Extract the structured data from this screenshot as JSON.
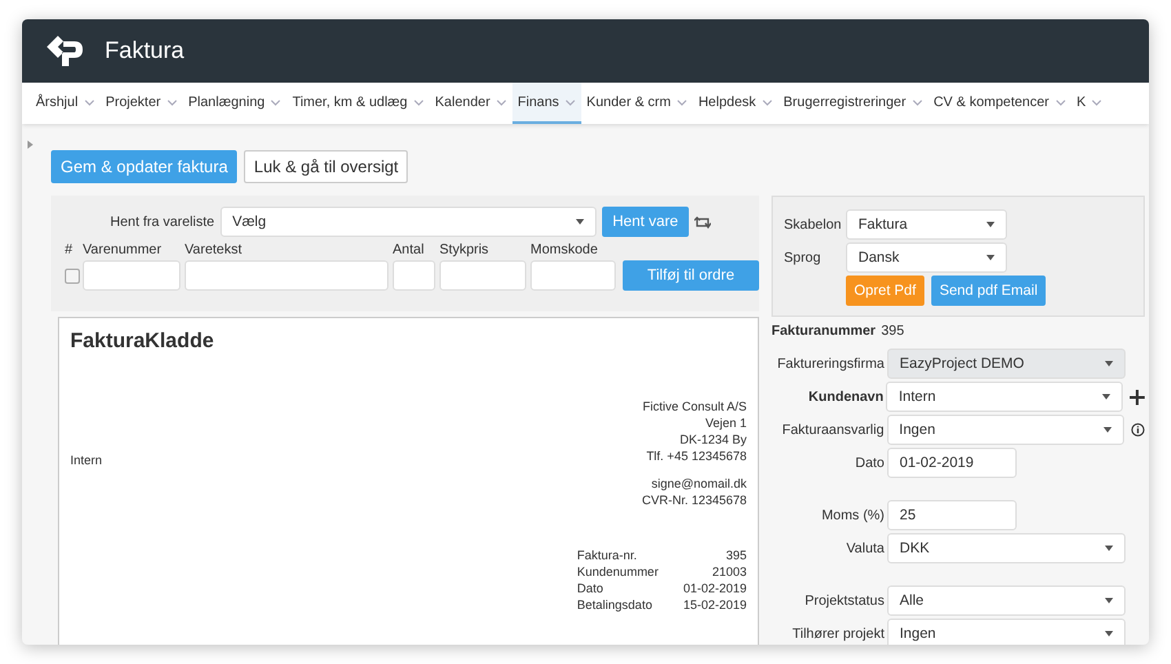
{
  "header": {
    "title": "Faktura"
  },
  "nav": [
    {
      "label": "Årshjul",
      "selected": false
    },
    {
      "label": "Projekter",
      "selected": false
    },
    {
      "label": "Planlægning",
      "selected": false
    },
    {
      "label": "Timer, km & udlæg",
      "selected": false
    },
    {
      "label": "Kalender",
      "selected": false
    },
    {
      "label": "Finans",
      "selected": true
    },
    {
      "label": "Kunder & crm",
      "selected": false
    },
    {
      "label": "Helpdesk",
      "selected": false
    },
    {
      "label": "Brugerregistreringer",
      "selected": false
    },
    {
      "label": "CV & kompetencer",
      "selected": false
    },
    {
      "label": "K",
      "selected": false
    }
  ],
  "actions": [
    {
      "label": "Gem & opdater faktura",
      "kind": "primary"
    },
    {
      "label": "Luk & gå til oversigt",
      "kind": "default"
    }
  ],
  "item_entry": {
    "pick_label": "Hent fra vareliste",
    "pick_value": "Vælg",
    "pick_button": "Hent vare",
    "columns": [
      "#",
      "Varenummer",
      "Varetekst",
      "Antal",
      "Stykpris",
      "Momskode"
    ],
    "row_checked": false,
    "add_button": "Tilføj til ordre"
  },
  "pdf_panel": {
    "fields": [
      {
        "label": "Skabelon",
        "value": "Faktura"
      },
      {
        "label": "Sprog",
        "value": "Dansk"
      }
    ],
    "buttons": [
      {
        "label": "Opret Pdf",
        "kind": "warning"
      },
      {
        "label": "Send pdf Email",
        "kind": "primary"
      }
    ]
  },
  "invoice_form": [
    [
      {
        "kind": "text",
        "label": "Fakturanummer",
        "value": "395",
        "bold": true,
        "add_button": false,
        "info_icon": false
      },
      {
        "kind": "select",
        "label": "Faktureringsfirma",
        "value": "EazyProject DEMO",
        "bold": false,
        "disabled": true,
        "add_button": false,
        "info_icon": false
      },
      {
        "kind": "select",
        "label": "Kundenavn",
        "value": "Intern",
        "bold": true,
        "disabled": false,
        "add_button": true,
        "info_icon": false
      },
      {
        "kind": "select",
        "label": "Fakturaansvarlig",
        "value": "Ingen",
        "bold": false,
        "disabled": false,
        "add_button": false,
        "info_icon": true
      },
      {
        "kind": "input",
        "label": "Dato",
        "value": "01-02-2019",
        "bold": false,
        "add_button": false,
        "info_icon": false
      }
    ],
    [
      {
        "kind": "input",
        "label": "Moms (%)",
        "value": "25",
        "bold": false,
        "add_button": false,
        "info_icon": false
      },
      {
        "kind": "select",
        "label": "Valuta",
        "value": "DKK",
        "bold": false,
        "disabled": false,
        "add_button": false,
        "info_icon": false
      }
    ],
    [
      {
        "kind": "select",
        "label": "Projektstatus",
        "value": "Alle",
        "bold": false,
        "disabled": false,
        "add_button": false,
        "info_icon": false
      },
      {
        "kind": "select",
        "label": "Tilhører projekt",
        "value": "Ingen",
        "bold": false,
        "disabled": false,
        "add_button": false,
        "info_icon": false
      }
    ]
  ],
  "preview": {
    "title": "FakturaKladde",
    "customer": "Intern",
    "sender": [
      [
        "Fictive Consult A/S",
        "Vejen 1",
        "DK-1234 By",
        "Tlf. +45 12345678"
      ],
      [
        "signe@nomail.dk",
        "CVR-Nr. 12345678"
      ]
    ],
    "details": [
      {
        "label": "Faktura-nr.",
        "value": "395"
      },
      {
        "label": "Kundenummer",
        "value": "21003"
      },
      {
        "label": "Dato",
        "value": "01-02-2019"
      },
      {
        "label": "Betalingsdato",
        "value": "15-02-2019"
      }
    ]
  }
}
